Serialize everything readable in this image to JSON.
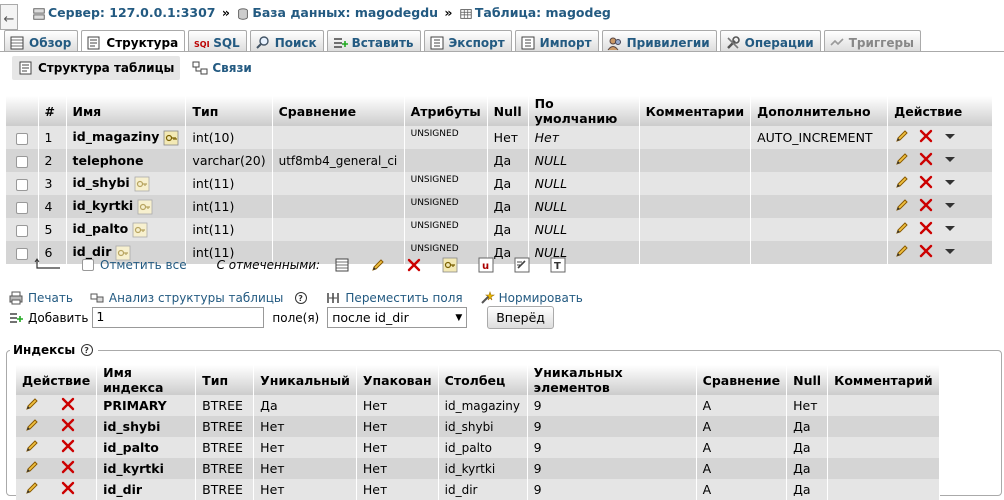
{
  "breadcrumb": {
    "server": "Сервер: 127.0.0.1:3307",
    "database": "База данных: magodegdu",
    "table": "Таблица: magodeg",
    "sep": "»"
  },
  "tabs": [
    {
      "label": "Обзор",
      "icon": "browse-icon"
    },
    {
      "label": "Структура",
      "icon": "structure-icon"
    },
    {
      "label": "SQL",
      "icon": "sql-icon"
    },
    {
      "label": "Поиск",
      "icon": "search-icon"
    },
    {
      "label": "Вставить",
      "icon": "insert-icon"
    },
    {
      "label": "Экспорт",
      "icon": "export-icon"
    },
    {
      "label": "Импорт",
      "icon": "import-icon"
    },
    {
      "label": "Привилегии",
      "icon": "privileges-icon"
    },
    {
      "label": "Операции",
      "icon": "operations-icon"
    },
    {
      "label": "Триггеры",
      "icon": "triggers-icon"
    }
  ],
  "subtabs": [
    {
      "label": "Структура таблицы",
      "icon": "structure-icon"
    },
    {
      "label": "Связи",
      "icon": "relations-icon"
    }
  ],
  "structure": {
    "headers": [
      "#",
      "Имя",
      "Тип",
      "Сравнение",
      "Атрибуты",
      "Null",
      "По умолчанию",
      "Комментарии",
      "Дополнительно",
      "Действие"
    ],
    "rows": [
      {
        "num": "1",
        "name": "id_magaziny",
        "type": "int(10)",
        "collation": "",
        "attributes": "UNSIGNED",
        "null": "Нет",
        "default": "Нет",
        "comments": "",
        "extra": "AUTO_INCREMENT"
      },
      {
        "num": "2",
        "name": "telephone",
        "type": "varchar(20)",
        "collation": "utf8mb4_general_ci",
        "attributes": "",
        "null": "Да",
        "default": "NULL",
        "comments": "",
        "extra": ""
      },
      {
        "num": "3",
        "name": "id_shybi",
        "type": "int(11)",
        "collation": "",
        "attributes": "UNSIGNED",
        "null": "Да",
        "default": "NULL",
        "comments": "",
        "extra": ""
      },
      {
        "num": "4",
        "name": "id_kyrtki",
        "type": "int(11)",
        "collation": "",
        "attributes": "UNSIGNED",
        "null": "Да",
        "default": "NULL",
        "comments": "",
        "extra": ""
      },
      {
        "num": "5",
        "name": "id_palto",
        "type": "int(11)",
        "collation": "",
        "attributes": "UNSIGNED",
        "null": "Да",
        "default": "NULL",
        "comments": "",
        "extra": ""
      },
      {
        "num": "6",
        "name": "id_dir",
        "type": "int(11)",
        "collation": "",
        "attributes": "UNSIGNED",
        "null": "Да",
        "default": "NULL",
        "comments": "",
        "extra": ""
      }
    ]
  },
  "bulk": {
    "check_all": "Отметить все",
    "with_selected": "С отмеченными:"
  },
  "actions": {
    "print": "Печать",
    "analyze": "Анализ структуры таблицы",
    "move_columns": "Переместить поля",
    "normalize": "Нормировать"
  },
  "add_columns": {
    "label": "Добавить",
    "count": "1",
    "fields_label": "поле(я)",
    "position": "после id_dir",
    "go": "Вперёд"
  },
  "indexes": {
    "legend": "Индексы",
    "headers": [
      "Действие",
      "Имя индекса",
      "Тип",
      "Уникальный",
      "Упакован",
      "Столбец",
      "Уникальных элементов",
      "Сравнение",
      "Null",
      "Комментарий"
    ],
    "rows": [
      {
        "name": "PRIMARY",
        "type": "BTREE",
        "unique": "Да",
        "packed": "Нет",
        "column": "id_magaziny",
        "cardinality": "9",
        "collation": "A",
        "null": "Нет",
        "comment": ""
      },
      {
        "name": "id_shybi",
        "type": "BTREE",
        "unique": "Нет",
        "packed": "Нет",
        "column": "id_shybi",
        "cardinality": "9",
        "collation": "A",
        "null": "Да",
        "comment": ""
      },
      {
        "name": "id_palto",
        "type": "BTREE",
        "unique": "Нет",
        "packed": "Нет",
        "column": "id_palto",
        "cardinality": "9",
        "collation": "A",
        "null": "Да",
        "comment": ""
      },
      {
        "name": "id_kyrtki",
        "type": "BTREE",
        "unique": "Нет",
        "packed": "Нет",
        "column": "id_kyrtki",
        "cardinality": "9",
        "collation": "A",
        "null": "Да",
        "comment": ""
      },
      {
        "name": "id_dir",
        "type": "BTREE",
        "unique": "Нет",
        "packed": "Нет",
        "column": "id_dir",
        "cardinality": "9",
        "collation": "A",
        "null": "Да",
        "comment": ""
      }
    ]
  },
  "colors": {
    "link": "#235a81",
    "row_odd": "#e5e5e5",
    "row_even": "#d5d5d5",
    "delete": "#cc0000",
    "edit": "#e0a000"
  }
}
